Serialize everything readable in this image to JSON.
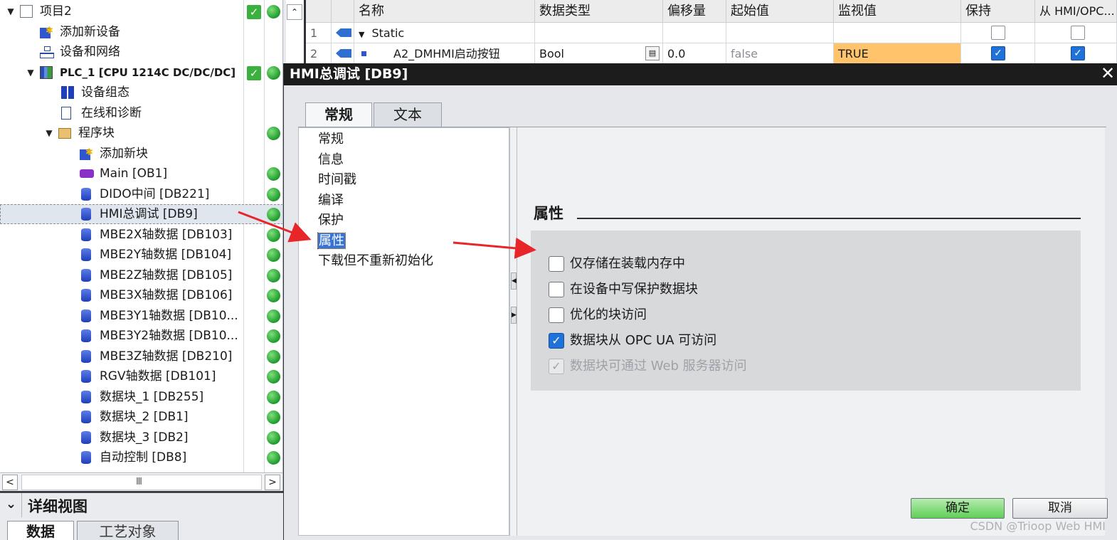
{
  "tree": {
    "items": [
      {
        "label": "项目2",
        "caret": "▼",
        "icon": "project-icon",
        "status": "both"
      },
      {
        "label": "添加新设备",
        "caret": "",
        "icon": "add-device-icon",
        "status": "none"
      },
      {
        "label": "设备和网络",
        "caret": "",
        "icon": "network-icon",
        "status": "none"
      },
      {
        "label": "PLC_1 [CPU 1214C DC/DC/DC]",
        "caret": "▼",
        "icon": "plc-icon",
        "status": "both"
      },
      {
        "label": "设备组态",
        "caret": "",
        "icon": "device-config-icon",
        "status": "none"
      },
      {
        "label": "在线和诊断",
        "caret": "",
        "icon": "diagnostics-icon",
        "status": "none"
      },
      {
        "label": "程序块",
        "caret": "▼",
        "icon": "folder-icon",
        "status": "dot"
      },
      {
        "label": "添加新块",
        "caret": "",
        "icon": "add-block-icon",
        "status": "none"
      },
      {
        "label": "Main [OB1]",
        "caret": "",
        "icon": "ob-icon",
        "status": "dot"
      },
      {
        "label": "DIDO中间 [DB221]",
        "caret": "",
        "icon": "db-icon",
        "status": "dot"
      },
      {
        "label": "HMI总调试 [DB9]",
        "caret": "",
        "icon": "db-icon",
        "status": "dot",
        "selected": true
      },
      {
        "label": "MBE2X轴数据 [DB103]",
        "caret": "",
        "icon": "db-icon",
        "status": "dot"
      },
      {
        "label": "MBE2Y轴数据 [DB104]",
        "caret": "",
        "icon": "db-icon",
        "status": "dot"
      },
      {
        "label": "MBE2Z轴数据 [DB105]",
        "caret": "",
        "icon": "db-icon",
        "status": "dot"
      },
      {
        "label": "MBE3X轴数据 [DB106]",
        "caret": "",
        "icon": "db-icon",
        "status": "dot"
      },
      {
        "label": "MBE3Y1轴数据 [DB10...",
        "caret": "",
        "icon": "db-icon",
        "status": "dot"
      },
      {
        "label": "MBE3Y2轴数据 [DB10...",
        "caret": "",
        "icon": "db-icon",
        "status": "dot"
      },
      {
        "label": "MBE3Z轴数据 [DB210]",
        "caret": "",
        "icon": "db-icon",
        "status": "dot"
      },
      {
        "label": "RGV轴数据 [DB101]",
        "caret": "",
        "icon": "db-icon",
        "status": "dot"
      },
      {
        "label": "数据块_1 [DB255]",
        "caret": "",
        "icon": "db-icon",
        "status": "dot"
      },
      {
        "label": "数据块_2 [DB1]",
        "caret": "",
        "icon": "db-icon",
        "status": "dot"
      },
      {
        "label": "数据块_3 [DB2]",
        "caret": "",
        "icon": "db-icon",
        "status": "dot"
      },
      {
        "label": "自动控制 [DB8]",
        "caret": "",
        "icon": "db-icon",
        "status": "dot"
      }
    ],
    "scroll_grip": "Ⅲ"
  },
  "detail_view": {
    "title": "详细视图",
    "caret": "⌄",
    "tabs": [
      "数据",
      "工艺对象"
    ]
  },
  "block_table": {
    "headers": [
      "名称",
      "数据类型",
      "偏移量",
      "起始值",
      "监视值",
      "保持",
      "从 HMI/OPC..."
    ],
    "rows": [
      {
        "num": "1",
        "name": "Static",
        "type": "",
        "offset": "",
        "start": "",
        "monitor": "",
        "retain": false,
        "hmi": false
      },
      {
        "num": "2",
        "name": "A2_DMHMI启动按钮",
        "type": "Bool",
        "offset": "0.0",
        "start": "false",
        "monitor": "TRUE",
        "retain": true,
        "hmi": true
      }
    ]
  },
  "dialog": {
    "title": "HMI总调试 [DB9]",
    "close": "✕",
    "tabs": [
      "常规",
      "文本"
    ],
    "nav": [
      "常规",
      "信息",
      "时间戳",
      "编译",
      "保护",
      "属性",
      "下载但不重新初始化"
    ],
    "selected_nav": "属性",
    "section_title": "属性",
    "options": [
      {
        "label": "仅存储在装载内存中",
        "checked": false,
        "disabled": false
      },
      {
        "label": "在设备中写保护数据块",
        "checked": false,
        "disabled": false
      },
      {
        "label": "优化的块访问",
        "checked": false,
        "disabled": false
      },
      {
        "label": "数据块从 OPC UA 可访问",
        "checked": true,
        "disabled": false
      },
      {
        "label": "数据块可通过 Web 服务器访问",
        "checked": true,
        "disabled": true
      }
    ],
    "ok_label": "确定",
    "cancel_label": "取消"
  },
  "watermark": "CSDN @Trioop Web HMI",
  "colors": {
    "accent": "#3874d8",
    "ok_button": "#5fcf56",
    "monitor_highlight": "#ffc46b",
    "annotation_arrow": "#e8262a",
    "status_green": "#3ab03e"
  }
}
